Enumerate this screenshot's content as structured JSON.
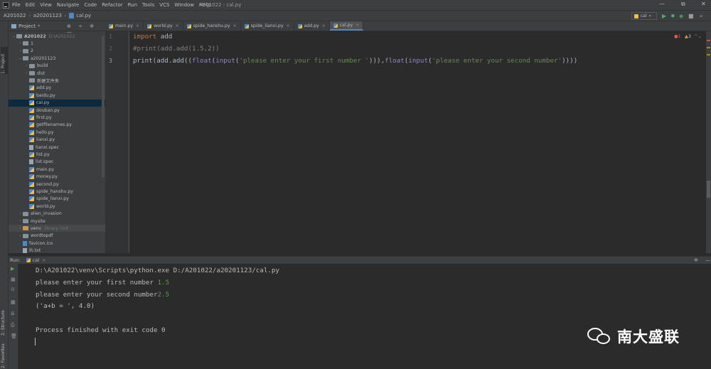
{
  "window": {
    "title": "A201022 - cal.py",
    "menu": [
      "File",
      "Edit",
      "View",
      "Navigate",
      "Code",
      "Refactor",
      "Run",
      "Tools",
      "VCS",
      "Window",
      "Help"
    ],
    "controls": [
      "—",
      "⧉",
      "✕"
    ]
  },
  "breadcrumb": [
    "A201022",
    "a20201123",
    "cal.py"
  ],
  "toolbar": {
    "run_config": "cal"
  },
  "left_stripe": {
    "project": "1: Project",
    "structure": "2: Structure",
    "favorites": "2: Favorites"
  },
  "project_panel": {
    "title": "Project",
    "tools": "⊕ ÷ ✲ —",
    "tree": [
      {
        "name": "A201022",
        "note": "D:\\A201022",
        "depth": 0,
        "type": "folder",
        "open": true
      },
      {
        "name": "1",
        "depth": 1,
        "type": "folder",
        "open": false
      },
      {
        "name": "2",
        "depth": 1,
        "type": "folder",
        "open": false
      },
      {
        "name": "a20201123",
        "depth": 1,
        "type": "folder",
        "open": true
      },
      {
        "name": "build",
        "depth": 2,
        "type": "folder",
        "open": false
      },
      {
        "name": "dist",
        "depth": 2,
        "type": "folder",
        "open": false
      },
      {
        "name": "新建文件夹",
        "depth": 2,
        "type": "folder",
        "leaf": true
      },
      {
        "name": "add.py",
        "depth": 2,
        "type": "py"
      },
      {
        "name": "baidu.py",
        "depth": 2,
        "type": "py"
      },
      {
        "name": "cal.py",
        "depth": 2,
        "type": "py",
        "selected": true
      },
      {
        "name": "douban.py",
        "depth": 2,
        "type": "py"
      },
      {
        "name": "first.py",
        "depth": 2,
        "type": "py"
      },
      {
        "name": "getfilenames.py",
        "depth": 2,
        "type": "py"
      },
      {
        "name": "hello.py",
        "depth": 2,
        "type": "py"
      },
      {
        "name": "lianxi.py",
        "depth": 2,
        "type": "py"
      },
      {
        "name": "lianxi.spec",
        "depth": 2,
        "type": "file"
      },
      {
        "name": "list.py",
        "depth": 2,
        "type": "py"
      },
      {
        "name": "list.spec",
        "depth": 2,
        "type": "file"
      },
      {
        "name": "main.py",
        "depth": 2,
        "type": "py"
      },
      {
        "name": "money.py",
        "depth": 2,
        "type": "py"
      },
      {
        "name": "second.py",
        "depth": 2,
        "type": "py"
      },
      {
        "name": "spide_hanshu.py",
        "depth": 2,
        "type": "py"
      },
      {
        "name": "spide_lianxi.py",
        "depth": 2,
        "type": "py"
      },
      {
        "name": "world.py",
        "depth": 2,
        "type": "py"
      },
      {
        "name": "alien_invasion",
        "depth": 1,
        "type": "folder",
        "open": false
      },
      {
        "name": "mysite",
        "depth": 1,
        "type": "folder",
        "open": false
      },
      {
        "name": "venv",
        "note": "library root",
        "depth": 1,
        "type": "folder-orange",
        "open": false,
        "highlight": true
      },
      {
        "name": "wordtopdf",
        "depth": 1,
        "type": "folder",
        "open": false
      },
      {
        "name": "favicon.ico",
        "depth": 1,
        "type": "ico"
      },
      {
        "name": "lh.txt",
        "depth": 1,
        "type": "file"
      }
    ]
  },
  "editor": {
    "tabs": [
      {
        "label": "main.py",
        "active": false
      },
      {
        "label": "world.py",
        "active": false
      },
      {
        "label": "spide_hanshu.py",
        "active": false
      },
      {
        "label": "spide_lianxi.py",
        "active": false
      },
      {
        "label": "add.py",
        "active": false
      },
      {
        "label": "cal.py",
        "active": true
      }
    ],
    "tab_close": "×",
    "line_numbers": [
      "1",
      "2",
      "3"
    ],
    "code": {
      "l1_kw": "import",
      "l1_rest": " add",
      "l2_comment": "#print(add.add(1.5,2))",
      "l3_a": "print(add.add((",
      "l3_float1": "float",
      "l3_b": "(",
      "l3_input1": "input",
      "l3_c": "(",
      "l3_str1": "'please enter your first number '",
      "l3_d": "))),",
      "l3_float2": "float",
      "l3_e": "(",
      "l3_input2": "input",
      "l3_f": "(",
      "l3_str2": "'please enter your second number'",
      "l3_g": "))))"
    },
    "inspection": {
      "errors": "1",
      "warnings": "3"
    }
  },
  "run_panel": {
    "label": "Run:",
    "tab": "cal",
    "lines": [
      {
        "text": "D:\\A201022\\venv\\Scripts\\python.exe D:/A201022/a20201123/cal.py",
        "input": ""
      },
      {
        "text": "please enter your first number ",
        "input": "1.5"
      },
      {
        "text": "please enter your second number",
        "input": "2.5"
      },
      {
        "text": "('a+b = ', 4.0)",
        "input": ""
      },
      {
        "text": "",
        "input": ""
      },
      {
        "text": "Process finished with exit code 0",
        "input": ""
      }
    ]
  },
  "watermark": {
    "text": "南大盛联"
  },
  "colors": {
    "keyword": "#cc7832",
    "string": "#6a8759",
    "comment": "#808080",
    "input": "#629755",
    "selection": "#0d293e"
  }
}
